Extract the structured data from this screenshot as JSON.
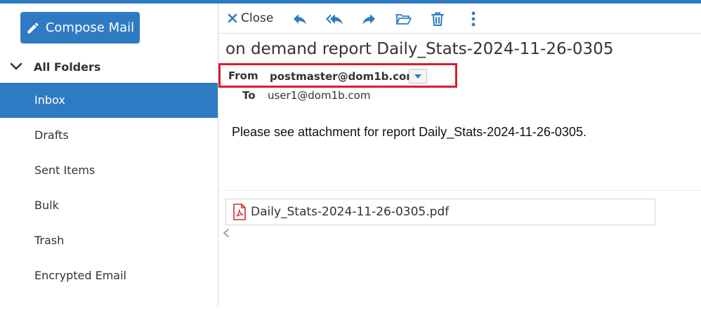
{
  "sidebar": {
    "compose_label": "Compose Mail",
    "folders_header": "All Folders",
    "folders": [
      {
        "label": "Inbox",
        "active": true
      },
      {
        "label": "Drafts",
        "active": false
      },
      {
        "label": "Sent Items",
        "active": false
      },
      {
        "label": "Bulk",
        "active": false
      },
      {
        "label": "Trash",
        "active": false
      },
      {
        "label": "Encrypted Email",
        "active": false
      }
    ]
  },
  "toolbar": {
    "close_label": "Close",
    "icons": [
      "reply-icon",
      "reply-all-icon",
      "forward-icon",
      "folder-move-icon",
      "trash-icon",
      "more-vertical-icon"
    ]
  },
  "message": {
    "subject": "on demand report Daily_Stats-2024-11-26-0305",
    "from_label": "From",
    "from_value": "postmaster@dom1b.com",
    "to_label": "To",
    "to_value": "user1@dom1b.com",
    "body": "Please see attachment for report Daily_Stats-2024-11-26-0305.",
    "attachment_name": "Daily_Stats-2024-11-26-0305.pdf"
  },
  "colors": {
    "accent": "#2f7bc3",
    "highlight_border": "#d4202a",
    "pdf_icon": "#c8302c"
  }
}
